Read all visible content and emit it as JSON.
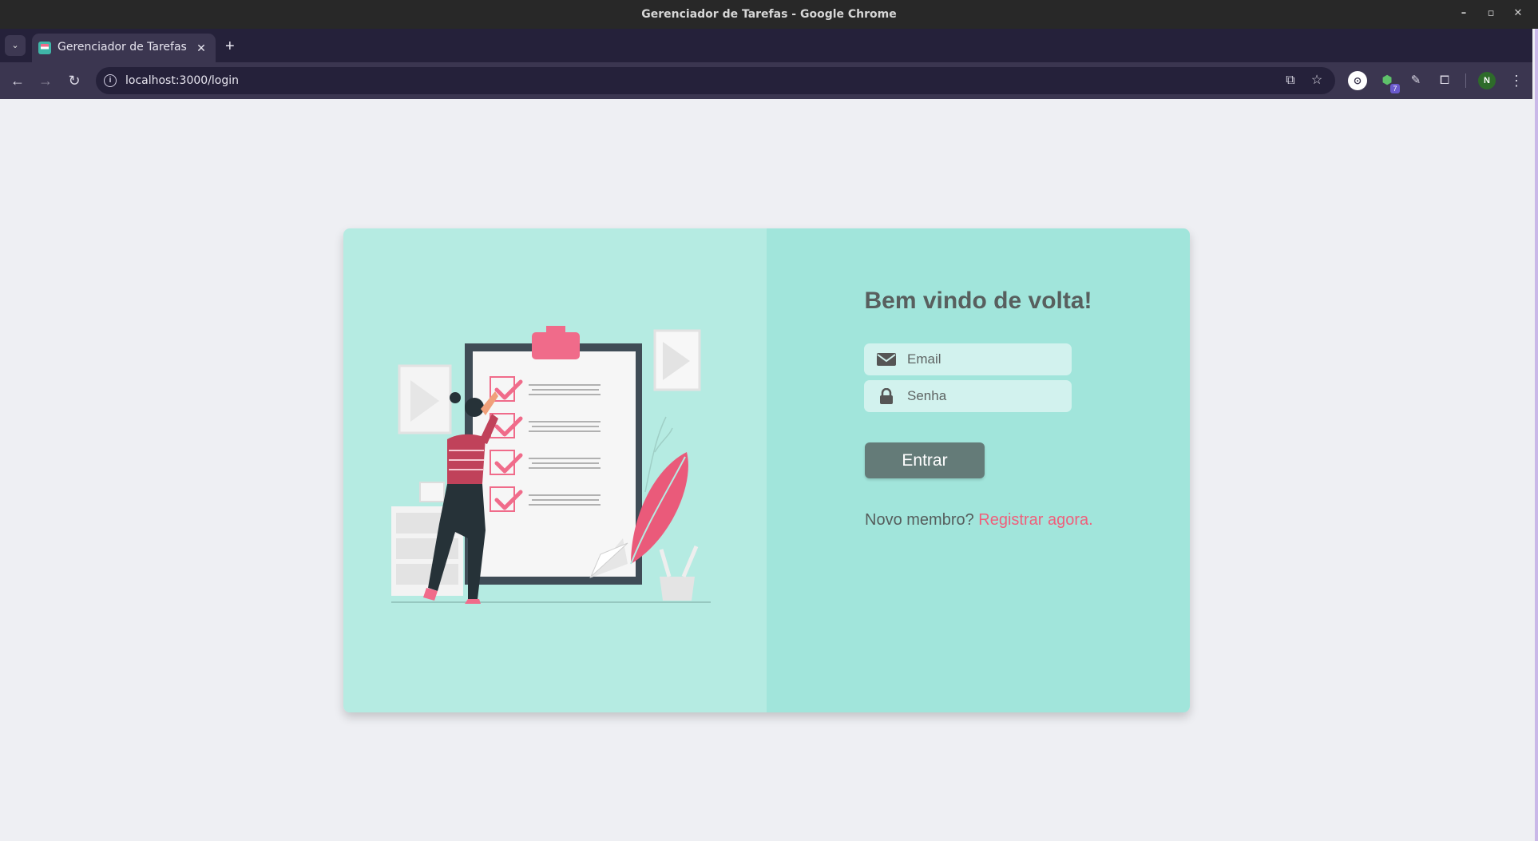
{
  "window": {
    "title": "Gerenciador de Tarefas - Google Chrome",
    "controls": {
      "minimize": "–",
      "maximize": "▫",
      "close": "✕"
    }
  },
  "tabs": [
    {
      "title": "Gerenciador de Tarefas",
      "favicon": "app-favicon-icon",
      "active": true
    }
  ],
  "tabbar": {
    "new_tab": "+",
    "close": "✕",
    "tab_list": "⌄"
  },
  "toolbar": {
    "url": "localhost:3000/login",
    "back": "←",
    "forward": "→",
    "reload": "↻",
    "info": "i",
    "open_in_app": "⧉",
    "bookmark": "☆",
    "extensions": [
      {
        "name": "extension-circle-icon",
        "glyph": "⊙"
      },
      {
        "name": "extension-cube-icon",
        "glyph": "⬢",
        "badge": "7"
      },
      {
        "name": "eyedropper-icon",
        "glyph": "✎"
      },
      {
        "name": "puzzle-icon",
        "glyph": "⧠"
      }
    ],
    "profile_initial": "N",
    "menu": "⋮"
  },
  "login": {
    "heading": "Bem vindo de volta!",
    "email_placeholder": "Email",
    "password_placeholder": "Senha",
    "submit_label": "Entrar",
    "register_prompt": "Novo membro?",
    "register_link": "Registrar agora."
  },
  "colors": {
    "accent_pink": "#ef5f7b",
    "left_panel": "#b5ebe2",
    "right_panel": "#a1e5db",
    "button": "#647b78",
    "page_bg": "#eeeff3"
  }
}
